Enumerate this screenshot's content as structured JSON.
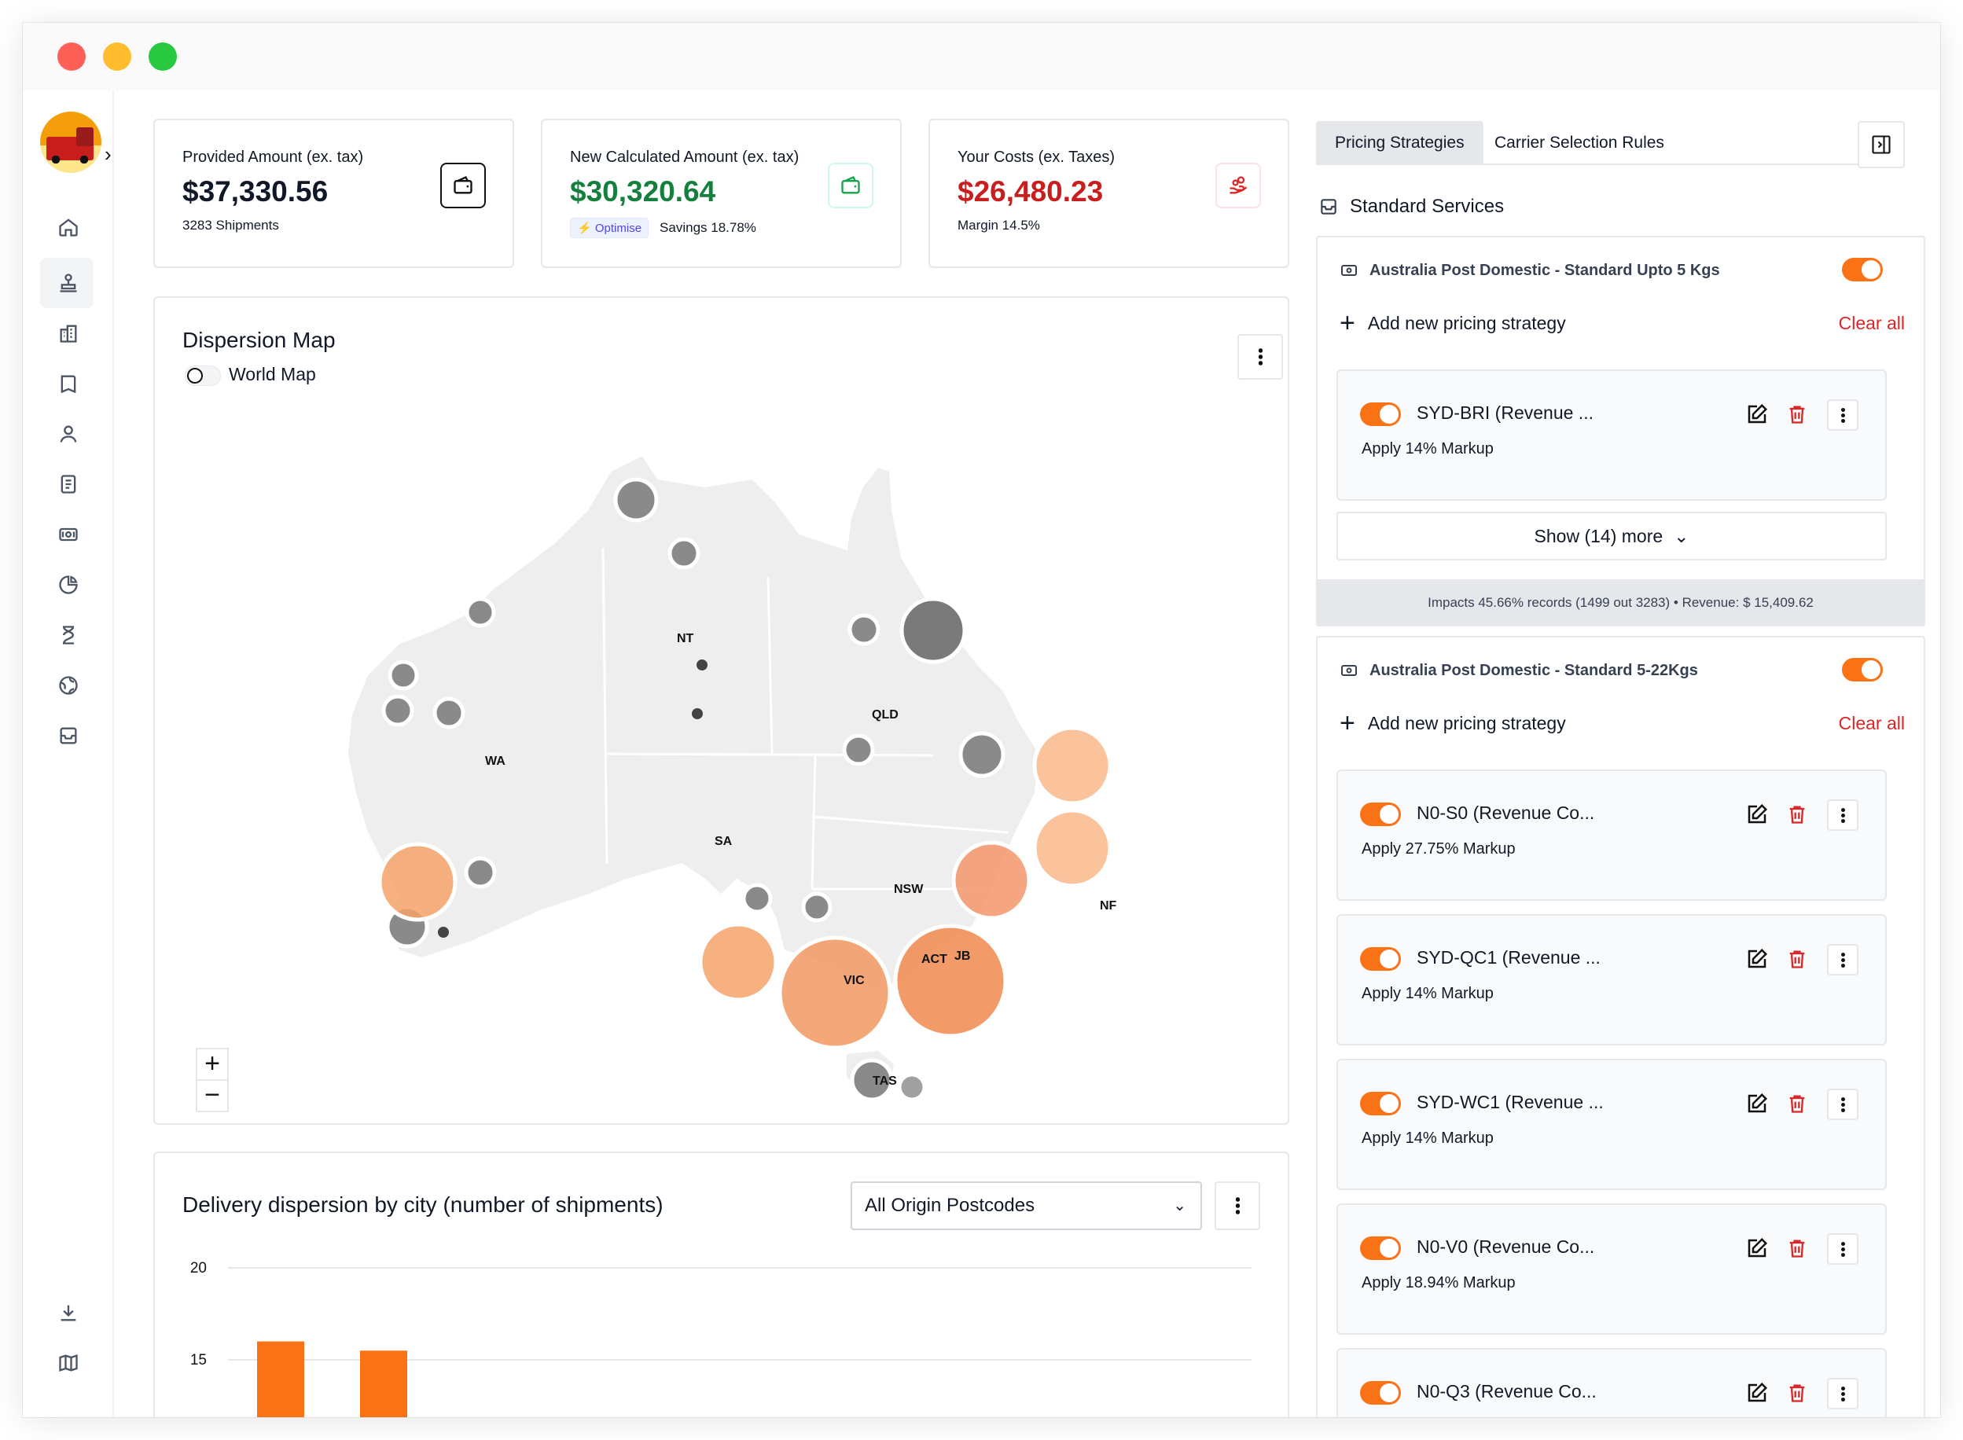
{
  "sidebar": {
    "items": [
      "home-icon",
      "parcel-user-icon",
      "buildings-icon",
      "book-icon",
      "user-icon",
      "document-icon",
      "banknote-icon",
      "chart-pie-icon",
      "hourglass-icon",
      "globe-icon",
      "archive-icon"
    ],
    "bottom_items": [
      "download-icon",
      "map-icon"
    ]
  },
  "stats": [
    {
      "label": "Provided Amount (ex. tax)",
      "amount": "$37,330.56",
      "sub": "3283 Shipments",
      "color": "#111827"
    },
    {
      "label": "New Calculated Amount (ex. tax)",
      "amount": "$30,320.64",
      "badge": "Optimise",
      "sub": "Savings 18.78%",
      "color": "#15803d"
    },
    {
      "label": "Your Costs (ex. Taxes)",
      "amount": "$26,480.23",
      "sub": "Margin 14.5%",
      "color": "#c81e1e"
    }
  ],
  "map": {
    "title": "Dispersion Map",
    "toggle_label": "World Map",
    "regions": [
      "WA",
      "NT",
      "SA",
      "QLD",
      "NSW",
      "ACT",
      "JB",
      "VIC",
      "TAS",
      "NF"
    ]
  },
  "city_chart": {
    "title": "Delivery dispersion by city (number of shipments)",
    "dropdown": "All Origin Postcodes"
  },
  "chart_data": {
    "type": "bar",
    "title": "Delivery dispersion by city (number of shipments)",
    "yticks": [
      20,
      15
    ],
    "values": [
      16,
      15.5
    ],
    "colors": {
      "bar": "#f97316"
    }
  },
  "right": {
    "tabs": [
      "Pricing Strategies",
      "Carrier Selection Rules"
    ],
    "section": "Standard Services",
    "add_label": "Add new pricing strategy",
    "clear_label": "Clear all",
    "groups": [
      {
        "title": "Australia Post Domestic - Standard Upto 5 Kgs",
        "strategies": [
          {
            "name": "SYD-BRI (Revenue ...",
            "desc": "Apply 14% Markup"
          }
        ],
        "show_more": "Show (14) more",
        "impact": "Impacts 45.66% records (1499 out 3283) • Revenue: $ 15,409.62"
      },
      {
        "title": "Australia Post Domestic - Standard 5-22Kgs",
        "strategies": [
          {
            "name": "N0-S0 (Revenue Co...",
            "desc": "Apply 27.75% Markup"
          },
          {
            "name": "SYD-QC1 (Revenue ...",
            "desc": "Apply 14% Markup"
          },
          {
            "name": "SYD-WC1 (Revenue ...",
            "desc": "Apply 14% Markup"
          },
          {
            "name": "N0-V0 (Revenue Co...",
            "desc": "Apply 18.94% Markup"
          },
          {
            "name": "N0-Q3 (Revenue Co...",
            "desc": ""
          }
        ]
      }
    ]
  }
}
